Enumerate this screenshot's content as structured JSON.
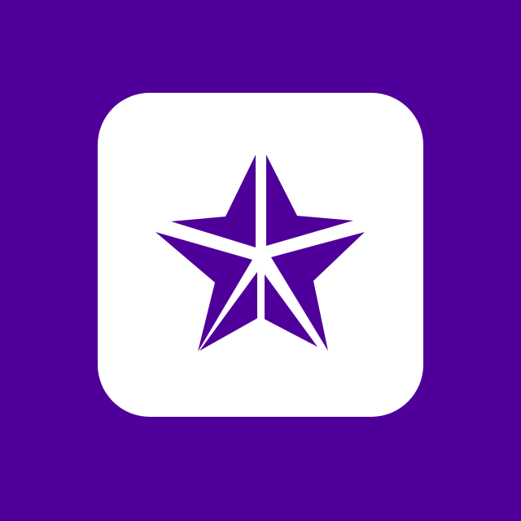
{
  "app": {
    "name": "star-logo",
    "icon": "star-icon"
  },
  "colors": {
    "background": "#50009A",
    "tile": "#FFFFFF",
    "star": "#50009A"
  }
}
